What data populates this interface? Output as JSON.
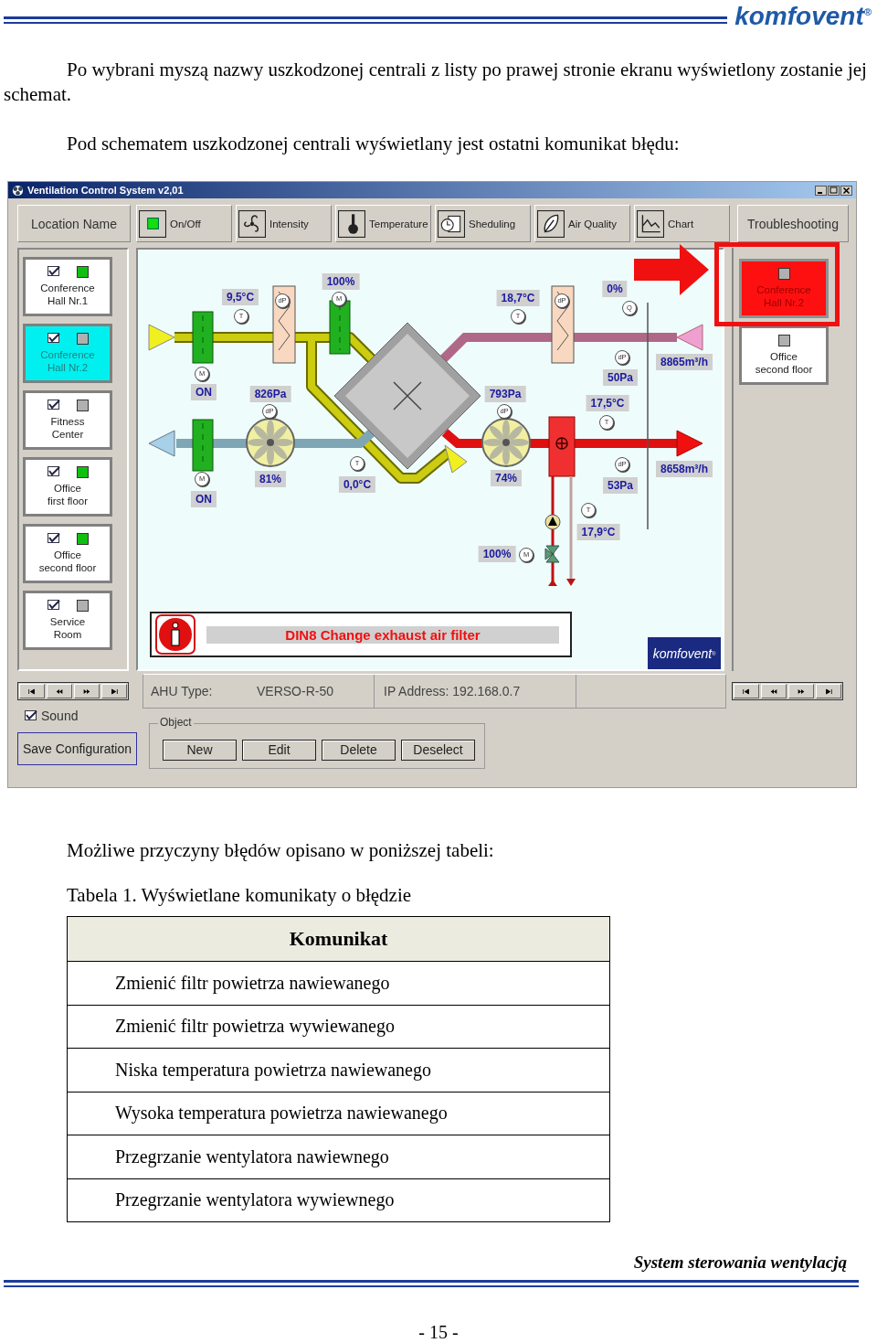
{
  "header": {
    "logo": "komfovent$^{®}$"
  },
  "paragraphs": [
    "Po wybrani myszą nazwy uszkodzonej centrali z listy po prawej stronie ekranu wyświetlony zostanie jej schemat.",
    "Pod schematem uszkodzonej centrali wyświetlany jest ostatni komunikat błędu:"
  ],
  "app_window": {
    "title": "Ventilation Control System v2,01",
    "toolbar": {
      "location_header": "Location Name",
      "buttons": [
        {
          "label": "On/Off",
          "kind": "onoff"
        },
        {
          "label": "Intensity",
          "kind": "fan"
        },
        {
          "label": "Temperature",
          "kind": "thermometer"
        },
        {
          "label": "Sheduling",
          "kind": "clock"
        },
        {
          "label": "Air Quality",
          "kind": "leaf"
        },
        {
          "label": "Chart",
          "kind": "chart"
        }
      ],
      "troubleshooting": "Troubleshooting"
    },
    "locations": [
      {
        "name_lines": [
          "Conference",
          "Hall Nr.1"
        ],
        "checked": true,
        "on": true,
        "selected": false
      },
      {
        "name_lines": [
          "Conference",
          "Hall Nr.2"
        ],
        "checked": true,
        "on": false,
        "selected": true
      },
      {
        "name_lines": [
          "Fitness",
          "Center"
        ],
        "checked": true,
        "on": false,
        "selected": false
      },
      {
        "name_lines": [
          "Office",
          "first floor"
        ],
        "checked": true,
        "on": true,
        "selected": false
      },
      {
        "name_lines": [
          "Office",
          "second floor"
        ],
        "checked": true,
        "on": true,
        "selected": false
      },
      {
        "name_lines": [
          "Service",
          "Room"
        ],
        "checked": true,
        "on": false,
        "selected": false
      }
    ],
    "faults": [
      {
        "name_lines": [
          "Conference",
          "Hall Nr.2"
        ],
        "alarm": true,
        "on": false
      },
      {
        "name_lines": [
          "Office",
          "second floor"
        ],
        "alarm": false,
        "on": false
      }
    ],
    "schematic": {
      "readings": [
        "9,5°C",
        "100%",
        "18,7°C",
        "0%",
        "8865m³/h",
        "50Pa",
        "ON",
        "826Pa",
        "793Pa",
        "17,5°C",
        "81%",
        "0,0°C",
        "74%",
        "8658m³/h",
        "53Pa",
        "ON",
        "17,9°C",
        "100%"
      ],
      "sensors": [
        "M",
        "T",
        "dP",
        "M",
        "dP",
        "M",
        "T",
        "dP",
        "T",
        "dP",
        "Q",
        "dP",
        "T",
        "dP",
        "T",
        "M"
      ],
      "alarm_message": "DIN8 Change exhaust air filter",
      "logo": "komfovent$^{®}$"
    },
    "status": {
      "ahu_type_label": "AHU Type:",
      "ahu_type": "VERSO-R-50",
      "ip_address": "IP Address: 192.168.0.7"
    },
    "sound": {
      "label": "Sound",
      "checked": true
    },
    "save_button": "Save Configuration",
    "object_group": {
      "title": "Object",
      "buttons": [
        "New",
        "Edit",
        "Delete",
        "Deselect"
      ]
    }
  },
  "text_after": "Możliwe przyczyny błędów opisano w poniższej tabeli:",
  "table": {
    "caption": "Tabela 1. Wyświetlane komunikaty o błędzie",
    "columns": [
      "Komunikat"
    ],
    "rows": [
      "Zmienić filtr powietrza nawiewanego",
      "Zmienić filtr powietrza wywiewanego",
      "Niska temperatura powietrza nawiewanego",
      "Wysoka temperatura powietrza nawiewanego",
      "Przegrzanie wentylatora nawiewnego",
      "Przegrzanie wentylatora wywiewnego"
    ]
  },
  "footer": {
    "title": "System sterowania wentylacją",
    "page_number": "- 15 -"
  }
}
